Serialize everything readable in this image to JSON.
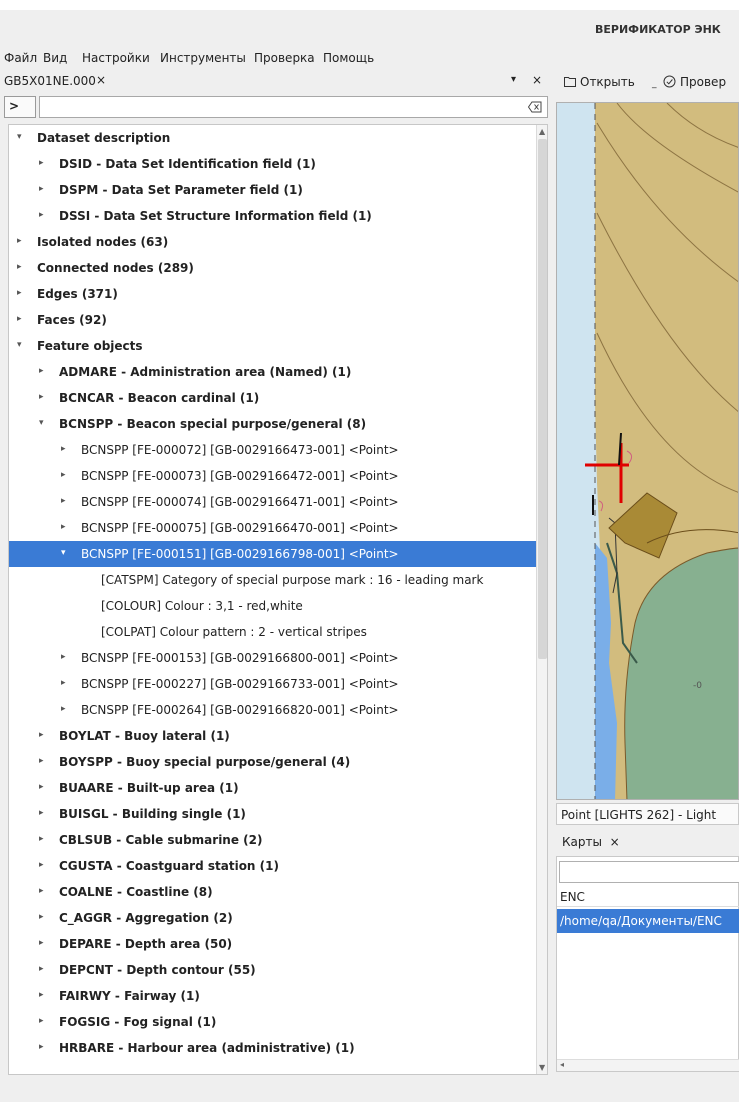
{
  "window": {
    "title": "ВЕРИФИКАТОР ЭНК"
  },
  "menu": [
    "Файл",
    "Вид",
    "Настройки",
    "Инструменты",
    "Проверка",
    "Помощь"
  ],
  "left_tab": {
    "label": "GB5X01NE.000",
    "close": "×",
    "dropdown": "▾",
    "close2": "×"
  },
  "filter": {
    "expand": ">",
    "value": "",
    "placeholder": ""
  },
  "tree": [
    {
      "label": "Dataset description",
      "level": 0,
      "arrow": "▾",
      "bold": true
    },
    {
      "label": "DSID - Data Set Identification field (1)",
      "level": 1,
      "arrow": "▸",
      "bold": true
    },
    {
      "label": "DSPM - Data Set Parameter field (1)",
      "level": 1,
      "arrow": "▸",
      "bold": true
    },
    {
      "label": "DSSI - Data Set Structure Information field (1)",
      "level": 1,
      "arrow": "▸",
      "bold": true
    },
    {
      "label": "Isolated nodes (63)",
      "level": 0,
      "arrow": "▸",
      "bold": true
    },
    {
      "label": "Connected nodes (289)",
      "level": 0,
      "arrow": "▸",
      "bold": true
    },
    {
      "label": "Edges (371)",
      "level": 0,
      "arrow": "▸",
      "bold": true
    },
    {
      "label": "Faces (92)",
      "level": 0,
      "arrow": "▸",
      "bold": true
    },
    {
      "label": "Feature objects",
      "level": 0,
      "arrow": "▾",
      "bold": true
    },
    {
      "label": "ADMARE - Administration area (Named) (1)",
      "level": 1,
      "arrow": "▸",
      "bold": true
    },
    {
      "label": "BCNCAR - Beacon cardinal (1)",
      "level": 1,
      "arrow": "▸",
      "bold": true
    },
    {
      "label": "BCNSPP - Beacon special purpose/general (8)",
      "level": 1,
      "arrow": "▾",
      "bold": true
    },
    {
      "label": "BCNSPP [FE-000072] [GB-0029166473-001] <Point>",
      "level": 2,
      "arrow": "▸",
      "bold": false
    },
    {
      "label": "BCNSPP [FE-000073] [GB-0029166472-001] <Point>",
      "level": 2,
      "arrow": "▸",
      "bold": false
    },
    {
      "label": "BCNSPP [FE-000074] [GB-0029166471-001] <Point>",
      "level": 2,
      "arrow": "▸",
      "bold": false
    },
    {
      "label": "BCNSPP [FE-000075] [GB-0029166470-001] <Point>",
      "level": 2,
      "arrow": "▸",
      "bold": false
    },
    {
      "label": "BCNSPP [FE-000151] [GB-0029166798-001] <Point>",
      "level": 2,
      "arrow": "▾",
      "bold": false,
      "selected": true
    },
    {
      "label": "[CATSPM] Category of special purpose mark : 16 - leading mark",
      "level": 3,
      "arrow": "",
      "bold": false
    },
    {
      "label": "[COLOUR] Colour : 3,1 - red,white",
      "level": 3,
      "arrow": "",
      "bold": false
    },
    {
      "label": "[COLPAT] Colour pattern : 2 - vertical stripes",
      "level": 3,
      "arrow": "",
      "bold": false
    },
    {
      "label": "BCNSPP [FE-000153] [GB-0029166800-001] <Point>",
      "level": 2,
      "arrow": "▸",
      "bold": false
    },
    {
      "label": "BCNSPP [FE-000227] [GB-0029166733-001] <Point>",
      "level": 2,
      "arrow": "▸",
      "bold": false
    },
    {
      "label": "BCNSPP [FE-000264] [GB-0029166820-001] <Point>",
      "level": 2,
      "arrow": "▸",
      "bold": false
    },
    {
      "label": "BOYLAT - Buoy lateral (1)",
      "level": 1,
      "arrow": "▸",
      "bold": true
    },
    {
      "label": "BOYSPP - Buoy special purpose/general (4)",
      "level": 1,
      "arrow": "▸",
      "bold": true
    },
    {
      "label": "BUAARE - Built-up area (1)",
      "level": 1,
      "arrow": "▸",
      "bold": true
    },
    {
      "label": "BUISGL - Building single (1)",
      "level": 1,
      "arrow": "▸",
      "bold": true
    },
    {
      "label": "CBLSUB - Cable submarine (2)",
      "level": 1,
      "arrow": "▸",
      "bold": true
    },
    {
      "label": "CGUSTA - Coastguard station (1)",
      "level": 1,
      "arrow": "▸",
      "bold": true
    },
    {
      "label": "COALNE - Coastline (8)",
      "level": 1,
      "arrow": "▸",
      "bold": true
    },
    {
      "label": "C_AGGR - Aggregation (2)",
      "level": 1,
      "arrow": "▸",
      "bold": true
    },
    {
      "label": "DEPARE - Depth area (50)",
      "level": 1,
      "arrow": "▸",
      "bold": true
    },
    {
      "label": "DEPCNT - Depth contour (55)",
      "level": 1,
      "arrow": "▸",
      "bold": true
    },
    {
      "label": "FAIRWY - Fairway (1)",
      "level": 1,
      "arrow": "▸",
      "bold": true
    },
    {
      "label": "FOGSIG - Fog signal (1)",
      "level": 1,
      "arrow": "▸",
      "bold": true
    },
    {
      "label": "HRBARE - Harbour area (administrative) (1)",
      "level": 1,
      "arrow": "▸",
      "bold": true
    }
  ],
  "toolbar": {
    "open_label": "Открыть",
    "check_label": "Провер"
  },
  "map": {
    "depth_label": "-0"
  },
  "status": {
    "text": "Point [LIGHTS 262] - Light"
  },
  "maps_tab": {
    "label": "Карты",
    "close": "×"
  },
  "maps_table": {
    "header": "ENC",
    "row": "/home/qa/Документы/ENC"
  },
  "colors": {
    "selection": "#3a7bd5",
    "land": "#d2bc7e",
    "green": "#87b090",
    "water": "#7aaee8",
    "pale_water": "#cfe4f0"
  }
}
